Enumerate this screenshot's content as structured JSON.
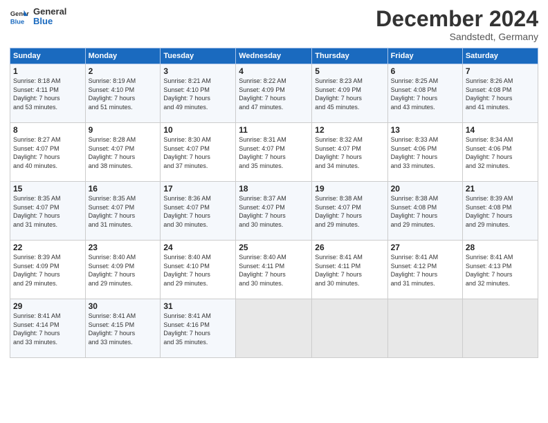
{
  "header": {
    "logo_general": "General",
    "logo_blue": "Blue",
    "main_title": "December 2024",
    "subtitle": "Sandstedt, Germany"
  },
  "days_of_week": [
    "Sunday",
    "Monday",
    "Tuesday",
    "Wednesday",
    "Thursday",
    "Friday",
    "Saturday"
  ],
  "weeks": [
    [
      {
        "day": "1",
        "sunrise": "8:18 AM",
        "sunset": "4:11 PM",
        "daylight": "7 hours and 53 minutes."
      },
      {
        "day": "2",
        "sunrise": "8:19 AM",
        "sunset": "4:10 PM",
        "daylight": "7 hours and 51 minutes."
      },
      {
        "day": "3",
        "sunrise": "8:21 AM",
        "sunset": "4:10 PM",
        "daylight": "7 hours and 49 minutes."
      },
      {
        "day": "4",
        "sunrise": "8:22 AM",
        "sunset": "4:09 PM",
        "daylight": "7 hours and 47 minutes."
      },
      {
        "day": "5",
        "sunrise": "8:23 AM",
        "sunset": "4:09 PM",
        "daylight": "7 hours and 45 minutes."
      },
      {
        "day": "6",
        "sunrise": "8:25 AM",
        "sunset": "4:08 PM",
        "daylight": "7 hours and 43 minutes."
      },
      {
        "day": "7",
        "sunrise": "8:26 AM",
        "sunset": "4:08 PM",
        "daylight": "7 hours and 41 minutes."
      }
    ],
    [
      {
        "day": "8",
        "sunrise": "8:27 AM",
        "sunset": "4:07 PM",
        "daylight": "7 hours and 40 minutes."
      },
      {
        "day": "9",
        "sunrise": "8:28 AM",
        "sunset": "4:07 PM",
        "daylight": "7 hours and 38 minutes."
      },
      {
        "day": "10",
        "sunrise": "8:30 AM",
        "sunset": "4:07 PM",
        "daylight": "7 hours and 37 minutes."
      },
      {
        "day": "11",
        "sunrise": "8:31 AM",
        "sunset": "4:07 PM",
        "daylight": "7 hours and 35 minutes."
      },
      {
        "day": "12",
        "sunrise": "8:32 AM",
        "sunset": "4:07 PM",
        "daylight": "7 hours and 34 minutes."
      },
      {
        "day": "13",
        "sunrise": "8:33 AM",
        "sunset": "4:06 PM",
        "daylight": "7 hours and 33 minutes."
      },
      {
        "day": "14",
        "sunrise": "8:34 AM",
        "sunset": "4:06 PM",
        "daylight": "7 hours and 32 minutes."
      }
    ],
    [
      {
        "day": "15",
        "sunrise": "8:35 AM",
        "sunset": "4:07 PM",
        "daylight": "7 hours and 31 minutes."
      },
      {
        "day": "16",
        "sunrise": "8:35 AM",
        "sunset": "4:07 PM",
        "daylight": "7 hours and 31 minutes."
      },
      {
        "day": "17",
        "sunrise": "8:36 AM",
        "sunset": "4:07 PM",
        "daylight": "7 hours and 30 minutes."
      },
      {
        "day": "18",
        "sunrise": "8:37 AM",
        "sunset": "4:07 PM",
        "daylight": "7 hours and 30 minutes."
      },
      {
        "day": "19",
        "sunrise": "8:38 AM",
        "sunset": "4:07 PM",
        "daylight": "7 hours and 29 minutes."
      },
      {
        "day": "20",
        "sunrise": "8:38 AM",
        "sunset": "4:08 PM",
        "daylight": "7 hours and 29 minutes."
      },
      {
        "day": "21",
        "sunrise": "8:39 AM",
        "sunset": "4:08 PM",
        "daylight": "7 hours and 29 minutes."
      }
    ],
    [
      {
        "day": "22",
        "sunrise": "8:39 AM",
        "sunset": "4:09 PM",
        "daylight": "7 hours and 29 minutes."
      },
      {
        "day": "23",
        "sunrise": "8:40 AM",
        "sunset": "4:09 PM",
        "daylight": "7 hours and 29 minutes."
      },
      {
        "day": "24",
        "sunrise": "8:40 AM",
        "sunset": "4:10 PM",
        "daylight": "7 hours and 29 minutes."
      },
      {
        "day": "25",
        "sunrise": "8:40 AM",
        "sunset": "4:11 PM",
        "daylight": "7 hours and 30 minutes."
      },
      {
        "day": "26",
        "sunrise": "8:41 AM",
        "sunset": "4:11 PM",
        "daylight": "7 hours and 30 minutes."
      },
      {
        "day": "27",
        "sunrise": "8:41 AM",
        "sunset": "4:12 PM",
        "daylight": "7 hours and 31 minutes."
      },
      {
        "day": "28",
        "sunrise": "8:41 AM",
        "sunset": "4:13 PM",
        "daylight": "7 hours and 32 minutes."
      }
    ],
    [
      {
        "day": "29",
        "sunrise": "8:41 AM",
        "sunset": "4:14 PM",
        "daylight": "7 hours and 33 minutes."
      },
      {
        "day": "30",
        "sunrise": "8:41 AM",
        "sunset": "4:15 PM",
        "daylight": "7 hours and 33 minutes."
      },
      {
        "day": "31",
        "sunrise": "8:41 AM",
        "sunset": "4:16 PM",
        "daylight": "7 hours and 35 minutes."
      },
      null,
      null,
      null,
      null
    ]
  ]
}
